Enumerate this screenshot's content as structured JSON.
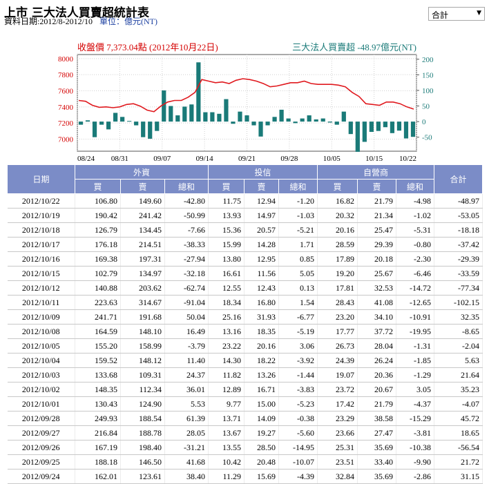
{
  "header": {
    "title": "上市 三大法人買賣超統計表",
    "period": "資料日期:2012/8-2012/10",
    "unit": "單位：億元(NT)"
  },
  "select": {
    "value": "合計"
  },
  "chart_data": {
    "type": "bar",
    "left_title": "收盤價 7,373.04點 (2012年10月22日)",
    "right_title": "三大法人買賣超 -48.97億元(NT)",
    "left_ticks": [
      "8000",
      "7800",
      "7600",
      "7400",
      "7200",
      "7000"
    ],
    "right_ticks": [
      "200",
      "150",
      "100",
      "50",
      "0",
      "-50"
    ],
    "x_ticks": [
      "08/24",
      "08/31",
      "09/07",
      "09/14",
      "09/21",
      "09/28",
      "10/05",
      "10/15",
      "10/22"
    ],
    "ylim_left": [
      6850,
      8050
    ],
    "ylim_right": [
      -95,
      215
    ],
    "bars": [
      -10,
      4,
      -50,
      -10,
      -25,
      28,
      15,
      2,
      -12,
      -50,
      -55,
      -30,
      100,
      50,
      20,
      48,
      55,
      190,
      30,
      30,
      25,
      72,
      -7,
      32,
      20,
      -12,
      -48,
      -12,
      15,
      38,
      10,
      -5,
      10,
      20,
      7,
      10,
      -3,
      -10,
      32,
      -40,
      -97,
      -65,
      -33,
      -30,
      -18,
      -37,
      -29,
      -54,
      -49
    ],
    "close": [
      7480,
      7470,
      7420,
      7395,
      7400,
      7390,
      7400,
      7430,
      7440,
      7410,
      7360,
      7340,
      7410,
      7460,
      7480,
      7480,
      7520,
      7580,
      7740,
      7720,
      7700,
      7710,
      7690,
      7730,
      7750,
      7740,
      7720,
      7690,
      7650,
      7660,
      7680,
      7700,
      7700,
      7720,
      7690,
      7680,
      7680,
      7680,
      7670,
      7650,
      7580,
      7530,
      7440,
      7430,
      7420,
      7460,
      7460,
      7440,
      7400,
      7373
    ]
  },
  "table": {
    "col_date": "日期",
    "groups": [
      "外資",
      "投信",
      "自營商"
    ],
    "col_total": "合計",
    "sub": [
      "買",
      "賣",
      "總和"
    ],
    "rows": [
      [
        "2012/10/22",
        "106.80",
        "149.60",
        "-42.80",
        "11.75",
        "12.94",
        "-1.20",
        "16.82",
        "21.79",
        "-4.98",
        "-48.97"
      ],
      [
        "2012/10/19",
        "190.42",
        "241.42",
        "-50.99",
        "13.93",
        "14.97",
        "-1.03",
        "20.32",
        "21.34",
        "-1.02",
        "-53.05"
      ],
      [
        "2012/10/18",
        "126.79",
        "134.45",
        "-7.66",
        "15.36",
        "20.57",
        "-5.21",
        "20.16",
        "25.47",
        "-5.31",
        "-18.18"
      ],
      [
        "2012/10/17",
        "176.18",
        "214.51",
        "-38.33",
        "15.99",
        "14.28",
        "1.71",
        "28.59",
        "29.39",
        "-0.80",
        "-37.42"
      ],
      [
        "2012/10/16",
        "169.38",
        "197.31",
        "-27.94",
        "13.80",
        "12.95",
        "0.85",
        "17.89",
        "20.18",
        "-2.30",
        "-29.39"
      ],
      [
        "2012/10/15",
        "102.79",
        "134.97",
        "-32.18",
        "16.61",
        "11.56",
        "5.05",
        "19.20",
        "25.67",
        "-6.46",
        "-33.59"
      ],
      [
        "2012/10/12",
        "140.88",
        "203.62",
        "-62.74",
        "12.55",
        "12.43",
        "0.13",
        "17.81",
        "32.53",
        "-14.72",
        "-77.34"
      ],
      [
        "2012/10/11",
        "223.63",
        "314.67",
        "-91.04",
        "18.34",
        "16.80",
        "1.54",
        "28.43",
        "41.08",
        "-12.65",
        "-102.15"
      ],
      [
        "2012/10/09",
        "241.71",
        "191.68",
        "50.04",
        "25.16",
        "31.93",
        "-6.77",
        "23.20",
        "34.10",
        "-10.91",
        "32.35"
      ],
      [
        "2012/10/08",
        "164.59",
        "148.10",
        "16.49",
        "13.16",
        "18.35",
        "-5.19",
        "17.77",
        "37.72",
        "-19.95",
        "-8.65"
      ],
      [
        "2012/10/05",
        "155.20",
        "158.99",
        "-3.79",
        "23.22",
        "20.16",
        "3.06",
        "26.73",
        "28.04",
        "-1.31",
        "-2.04"
      ],
      [
        "2012/10/04",
        "159.52",
        "148.12",
        "11.40",
        "14.30",
        "18.22",
        "-3.92",
        "24.39",
        "26.24",
        "-1.85",
        "5.63"
      ],
      [
        "2012/10/03",
        "133.68",
        "109.31",
        "24.37",
        "11.82",
        "13.26",
        "-1.44",
        "19.07",
        "20.36",
        "-1.29",
        "21.64"
      ],
      [
        "2012/10/02",
        "148.35",
        "112.34",
        "36.01",
        "12.89",
        "16.71",
        "-3.83",
        "23.72",
        "20.67",
        "3.05",
        "35.23"
      ],
      [
        "2012/10/01",
        "130.43",
        "124.90",
        "5.53",
        "9.77",
        "15.00",
        "-5.23",
        "17.42",
        "21.79",
        "-4.37",
        "-4.07"
      ],
      [
        "2012/09/28",
        "249.93",
        "188.54",
        "61.39",
        "13.71",
        "14.09",
        "-0.38",
        "23.29",
        "38.58",
        "-15.29",
        "45.72"
      ],
      [
        "2012/09/27",
        "216.84",
        "188.78",
        "28.05",
        "13.67",
        "19.27",
        "-5.60",
        "23.66",
        "27.47",
        "-3.81",
        "18.65"
      ],
      [
        "2012/09/26",
        "167.19",
        "198.40",
        "-31.21",
        "13.55",
        "28.50",
        "-14.95",
        "25.31",
        "35.69",
        "-10.38",
        "-56.54"
      ],
      [
        "2012/09/25",
        "188.18",
        "146.50",
        "41.68",
        "10.42",
        "20.48",
        "-10.07",
        "23.51",
        "33.40",
        "-9.90",
        "21.72"
      ],
      [
        "2012/09/24",
        "162.01",
        "123.61",
        "38.40",
        "11.29",
        "15.69",
        "-4.39",
        "32.84",
        "35.69",
        "-2.86",
        "31.15"
      ]
    ]
  }
}
